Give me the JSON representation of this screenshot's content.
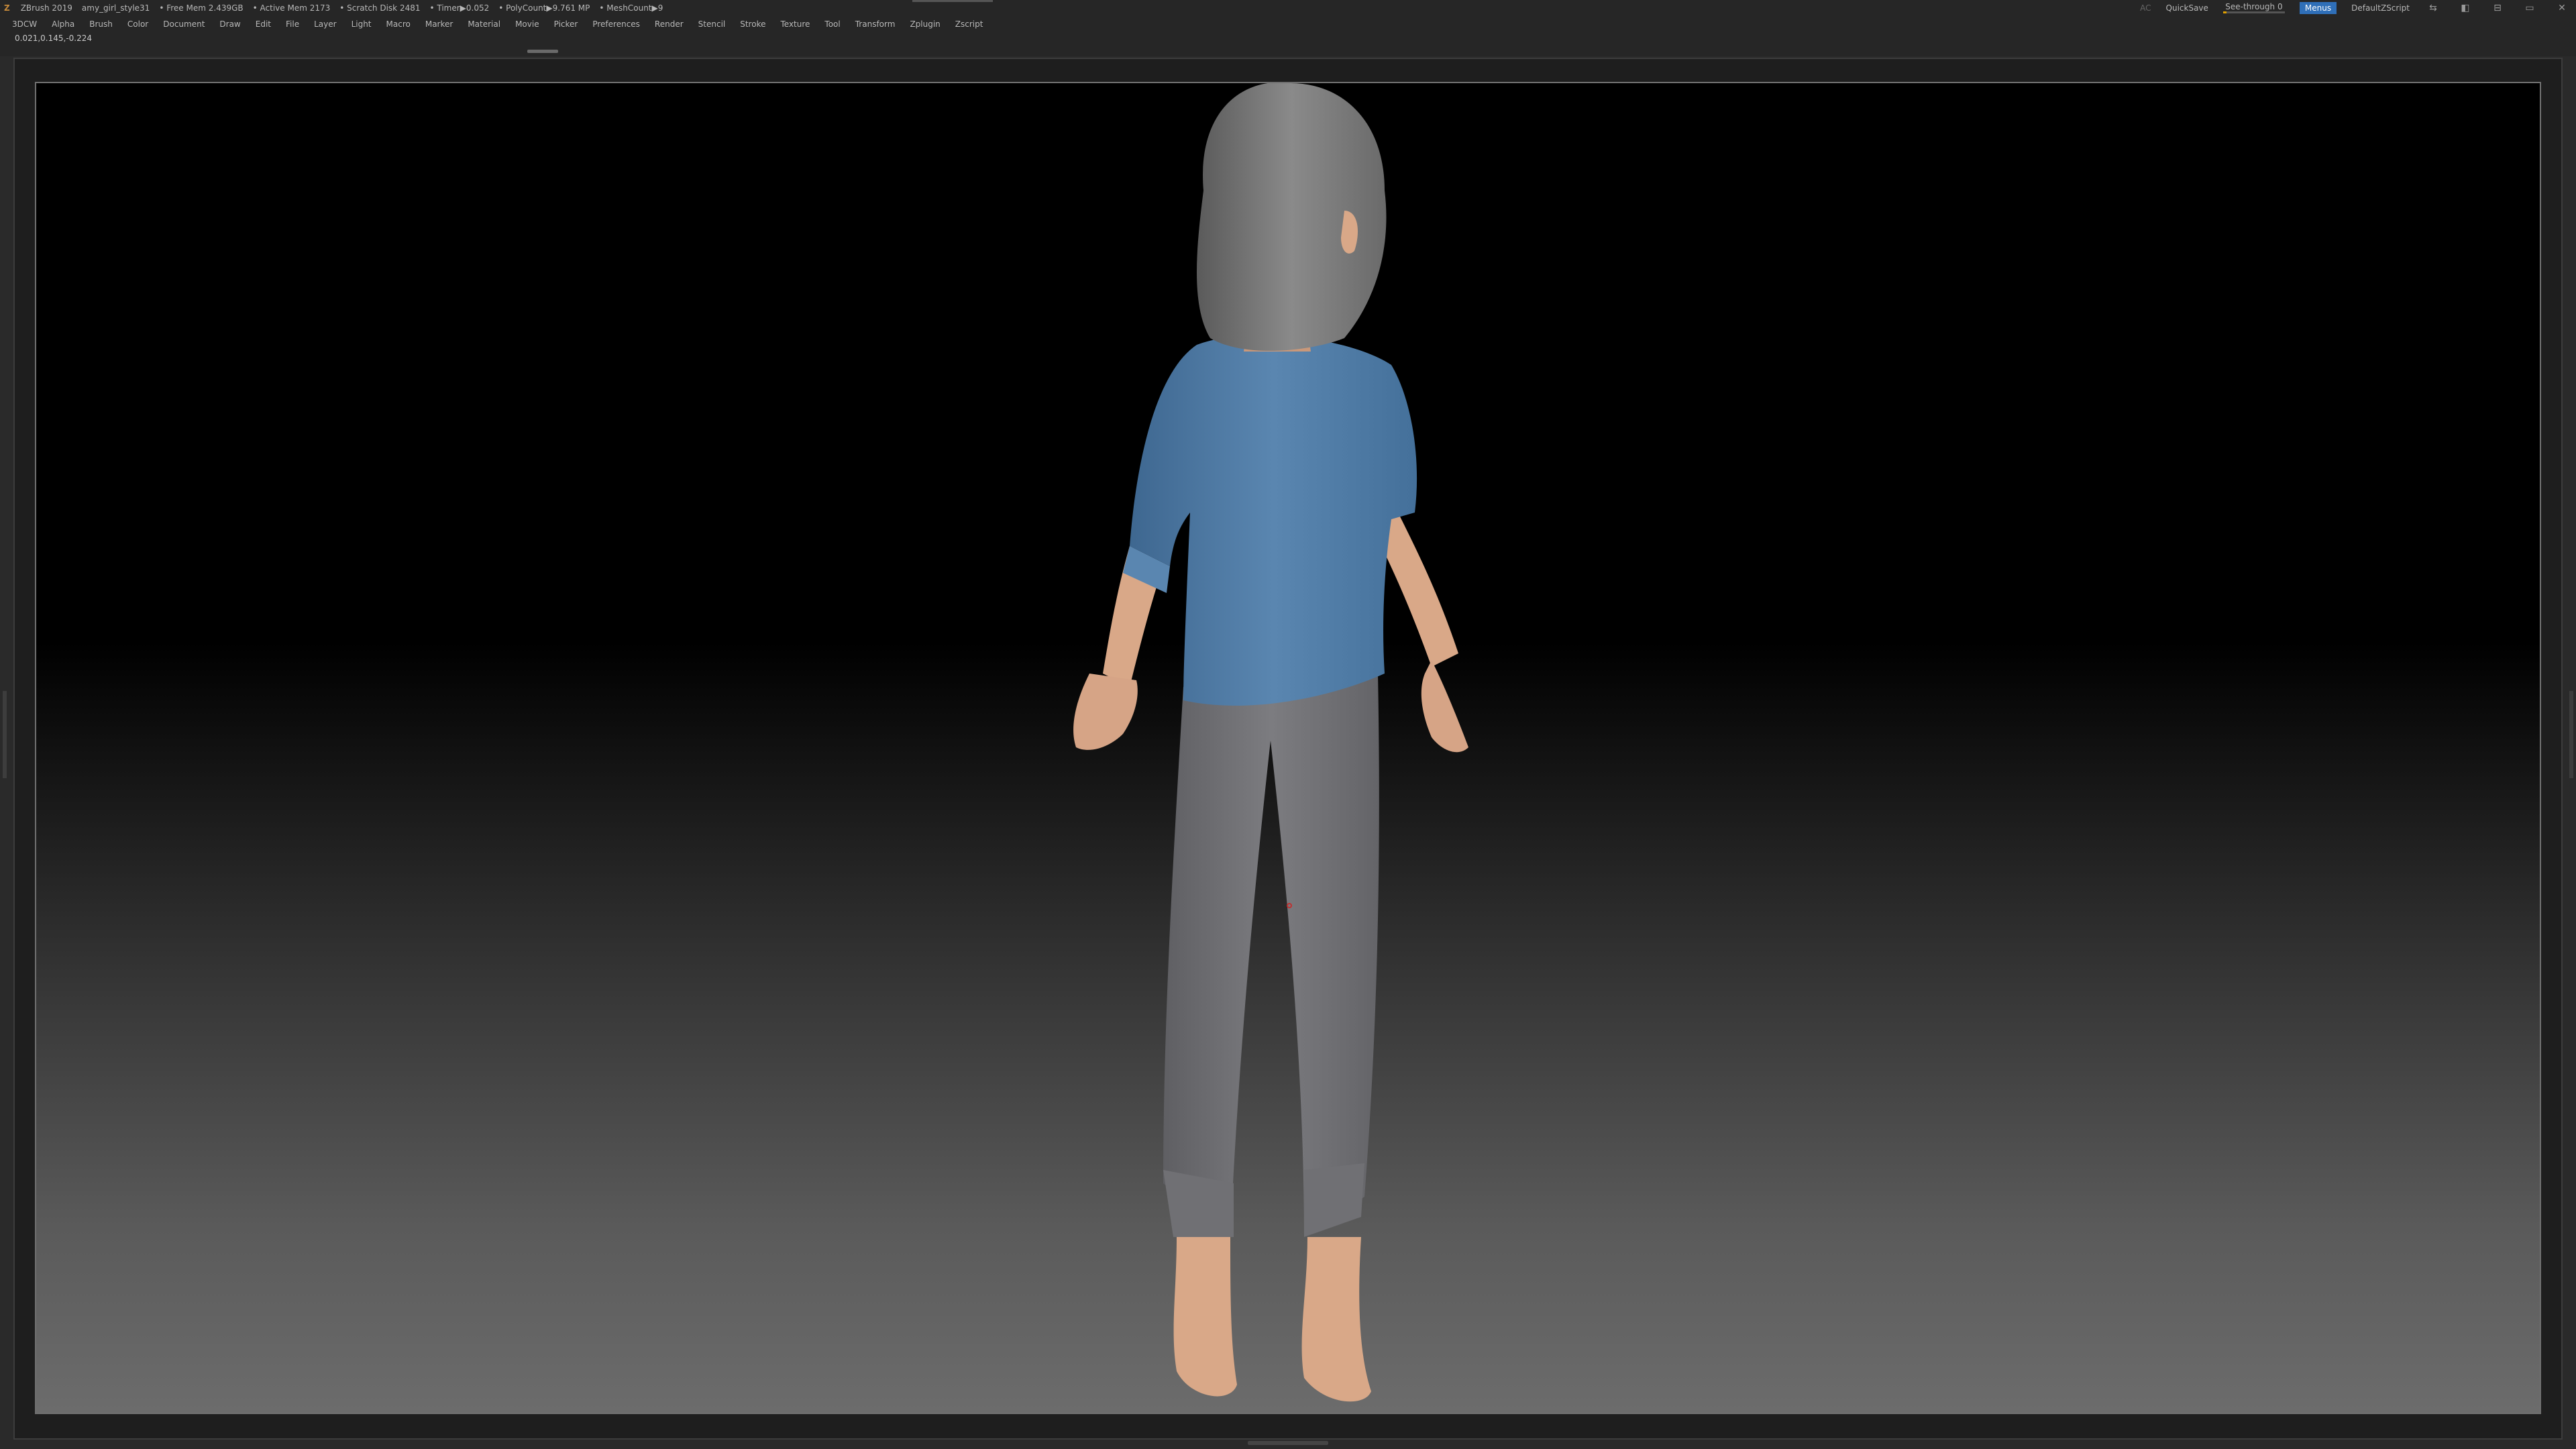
{
  "titlebar": {
    "app_icon": "zbrush-logo-icon",
    "app_name": "ZBrush 2019",
    "project": "amy_girl_style31",
    "free_mem": "• Free Mem 2.439GB",
    "active_mem": "• Active Mem 2173",
    "scratch": "• Scratch Disk 2481",
    "timer": "• Timer▶0.052",
    "polycount": "• PolyCount▶9.761 MP",
    "meshcount": "• MeshCount▶9",
    "ac_label": "AC",
    "quicksave": "QuickSave",
    "see_through_label": "See-through 0",
    "see_through_value": 0.06,
    "menus_label": "Menus",
    "script_label": "DefaultZScript",
    "window_buttons": [
      "⇆",
      "◧",
      "⊟",
      "▭",
      "✕"
    ]
  },
  "menubar": {
    "items": [
      "3DCW",
      "Alpha",
      "Brush",
      "Color",
      "Document",
      "Draw",
      "Edit",
      "File",
      "Layer",
      "Light",
      "Macro",
      "Marker",
      "Material",
      "Movie",
      "Picker",
      "Preferences",
      "Render",
      "Stencil",
      "Stroke",
      "Texture",
      "Tool",
      "Transform",
      "Zplugin",
      "Zscript"
    ]
  },
  "info": {
    "coords": "0.021,0.145,-0.224"
  },
  "colors": {
    "shirt": "#4f7ba6",
    "pants": "#6e6e72",
    "skin": "#d9a888",
    "hair": "#7a7a7a",
    "accent": "#2f6fb8"
  }
}
